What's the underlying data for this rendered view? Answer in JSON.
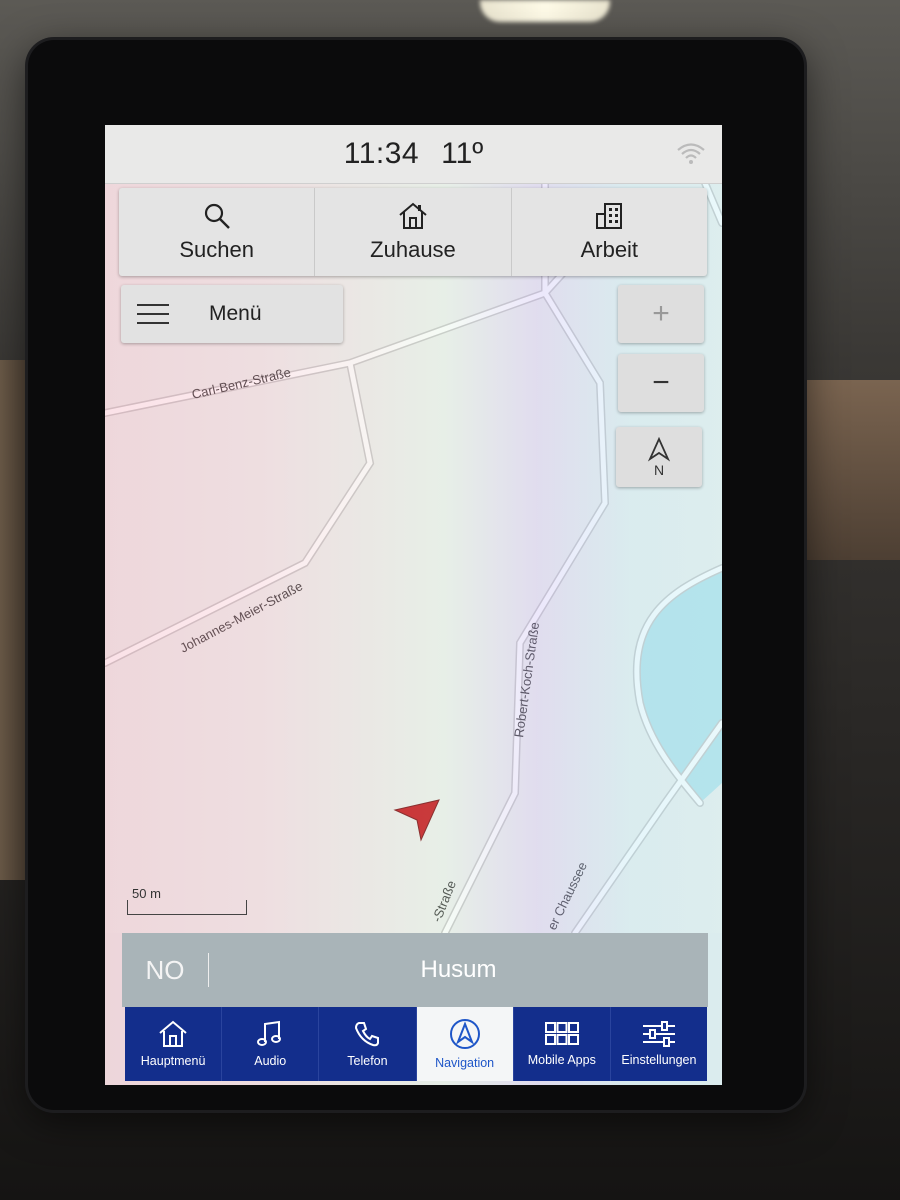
{
  "status": {
    "time": "11:34",
    "temperature": "11º"
  },
  "quick_actions": [
    {
      "label": "Suchen",
      "icon": "search-icon"
    },
    {
      "label": "Zuhause",
      "icon": "home-icon"
    },
    {
      "label": "Arbeit",
      "icon": "building-icon"
    }
  ],
  "menu_label": "Menü",
  "zoom": {
    "in": "+",
    "out": "−"
  },
  "compass_label": "N",
  "map": {
    "roads": [
      "Carl-Benz-Straße",
      "Johannes-Meier-Straße",
      "Robert-Koch-Straße",
      "-Straße",
      "er Chaussee"
    ],
    "scale_label": "50 m",
    "position_marker_color": "#c8141c"
  },
  "info_bar": {
    "road_code": "NO",
    "destination": "Husum"
  },
  "bottom_nav": {
    "items": [
      {
        "label": "Hauptmenü",
        "icon": "home-icon"
      },
      {
        "label": "Audio",
        "icon": "music-note-icon"
      },
      {
        "label": "Telefon",
        "icon": "phone-icon"
      },
      {
        "label": "Navigation",
        "icon": "navigation-icon",
        "active": true
      },
      {
        "label": "Mobile Apps",
        "icon": "apps-grid-icon"
      },
      {
        "label": "Einstellungen",
        "icon": "settings-sliders-icon"
      }
    ],
    "active_color": "#1e56c8",
    "bar_color": "#132e8c"
  }
}
